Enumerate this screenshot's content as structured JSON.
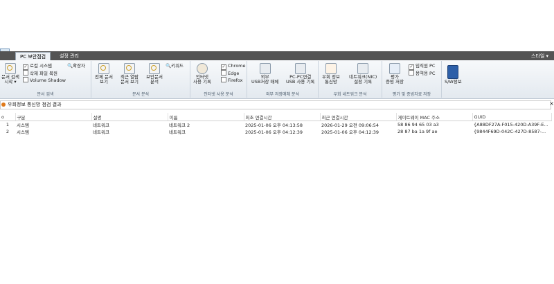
{
  "tabs": [
    {
      "label": "PC 보안점검"
    },
    {
      "label": "설정 관리"
    }
  ],
  "style_menu": "스타일 ▾",
  "groups": {
    "doc_search": {
      "label": "문서 검색",
      "start_button": "문서 검색\n시작 ▾",
      "options": [
        {
          "label": "로컬 시스템",
          "checked": true
        },
        {
          "label": "삭제 파일 복원",
          "checked": false
        },
        {
          "label": "Volume Shadow",
          "checked": false
        }
      ],
      "extension_button": "확장자"
    },
    "doc_analysis": {
      "label": "문서 분석",
      "buttons": [
        "전체 문서\n보기",
        "최근 열람\n문서 보기",
        "보안문서\n분석"
      ],
      "keyword_button": "키워드"
    },
    "internet": {
      "label": "인터넷 사용 분석",
      "history_button": "인터넷\n사용 기록",
      "browsers": [
        {
          "label": "Chrome",
          "checked": true
        },
        {
          "label": "Edge",
          "checked": false
        },
        {
          "label": "Firefox",
          "checked": false
        }
      ]
    },
    "external_storage": {
      "label": "외부 저장매체 분석",
      "buttons": [
        "외부\nUSB저장 매체",
        "PC-PC연결\nUSB 사용 기록"
      ]
    },
    "bypass_network": {
      "label": "우회 네트워크 분석",
      "buttons": [
        "우회 정보\n통신망",
        "네트워크(NIC)\n설정 기록"
      ]
    },
    "evidence": {
      "label": "평가 및 증빙자료 저장",
      "save_button": "평가\n증빙 저장",
      "options": [
        {
          "label": "임직원 PC",
          "checked": true
        },
        {
          "label": "용역용 PC",
          "checked": false
        }
      ]
    },
    "sw_info": {
      "button": "S/W정보"
    }
  },
  "result_title": "우회정보 통신망 점검 결과",
  "close_glyph": "×",
  "table": {
    "columns": [
      "o",
      "구분",
      "설명",
      "이름",
      "최초 연결시간",
      "최근 연결시간",
      "게이트웨이 MAC 주소",
      "GUID"
    ],
    "rows": [
      [
        "1",
        "시스템",
        "네트워크",
        "네트워크 2",
        "2025-01-06 오후 04:13:58",
        "2026-01-29 오전 09:06:54",
        "58 86 94 65 03 a3",
        "{A88DF27A-F015-420D-A39F-E..."
      ],
      [
        "2",
        "시스템",
        "네트워크",
        "네트워크",
        "2025-01-06 오후 04:12:39",
        "2025-01-06 오후 04:12:39",
        "28 87 ba 1a 9f ae",
        "{9844F69D-042C-427D-8587-..."
      ]
    ]
  }
}
